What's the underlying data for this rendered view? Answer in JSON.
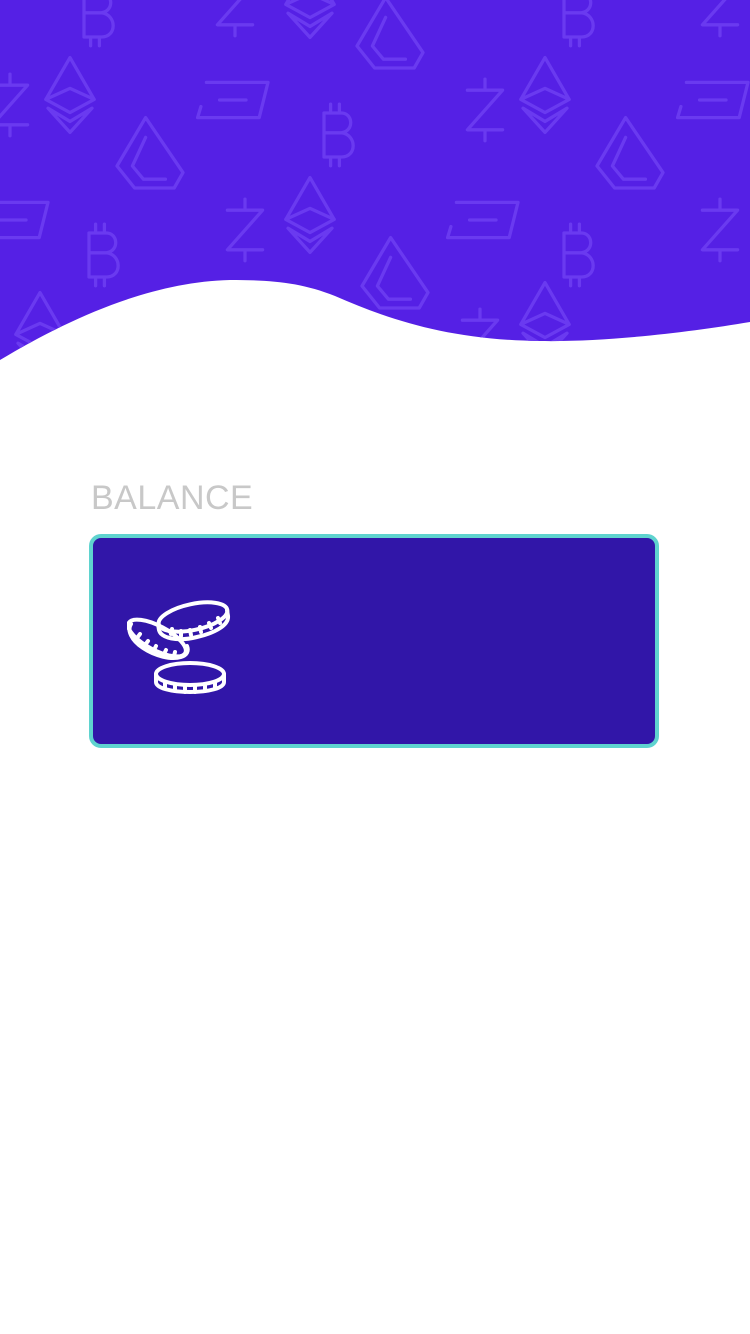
{
  "theme": {
    "header_color": "#5520e5",
    "pattern_color": "#6a3af0",
    "label_color": "#c8c8c8",
    "card_color": "#3116a8",
    "card_border_color": "#5fd3cf",
    "icon_color": "#ffffff"
  },
  "header": {
    "pattern_icons": [
      "bitcoin-icon",
      "ethereum-icon",
      "dash-icon",
      "lisk-icon",
      "zcash-icon"
    ]
  },
  "balance": {
    "label": "BALANCE",
    "icon": "coins-icon",
    "value": ""
  }
}
